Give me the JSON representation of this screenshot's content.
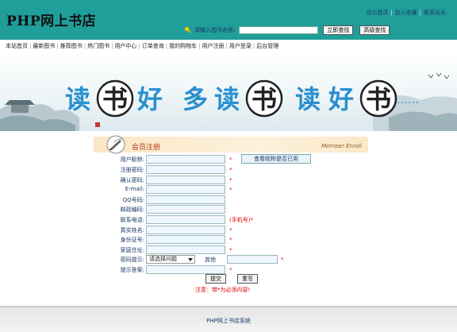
{
  "header": {
    "site_title": "PHP网上书店",
    "top_links": [
      "设为首页",
      "加入收藏",
      "联系站长"
    ],
    "search": {
      "label": "请输入图书名称:",
      "value": "",
      "placeholder": "",
      "buttons": [
        "立即查找",
        "高级查找"
      ]
    }
  },
  "nav": {
    "items": [
      "本站首页",
      "最新图书",
      "推荐图书",
      "热门图书",
      "用户中心",
      "订单查询",
      "我的购物车",
      "用户注册",
      "用户登录",
      "后台管理"
    ]
  },
  "banner": {
    "slogan_parts": [
      "读",
      "书",
      "好",
      "多",
      "读",
      "书",
      "读",
      "好",
      "书",
      "……"
    ]
  },
  "form": {
    "title": "会员注册",
    "title_en": "Member Enroll",
    "fields": [
      {
        "label": "用户昵称:",
        "value": "",
        "required": true
      },
      {
        "label": "注册密码:",
        "value": "",
        "required": true
      },
      {
        "label": "确认密码:",
        "value": "",
        "required": true
      },
      {
        "label": "E-mail:",
        "value": "",
        "required": true
      },
      {
        "label": "QQ号码:",
        "value": "",
        "required": false
      },
      {
        "label": "邮政编码:",
        "value": "",
        "required": false
      },
      {
        "label": "联系电话:",
        "value": "",
        "required": true,
        "hint": "(手机号)*"
      },
      {
        "label": "真实姓名:",
        "value": "",
        "required": true
      },
      {
        "label": "身份证号:",
        "value": "",
        "required": true
      },
      {
        "label": "家庭住址:",
        "value": "",
        "required": true
      }
    ],
    "check_button": "查看昵称是否已用",
    "question": {
      "label": "密码提示:",
      "selected": "请选择问题",
      "other_label": "其他",
      "other_value": ""
    },
    "answer": {
      "label": "提示答案:",
      "value": ""
    },
    "star": "*",
    "submit_label": "提交",
    "reset_label": "重写",
    "notice": "注意：带*为必添内容!"
  },
  "footer": {
    "text": "PHP网上书店系统"
  },
  "colors": {
    "header_bg": "#1f9e9a",
    "required": "#dd0000",
    "label": "#1a3a6a",
    "slogan": "#2a8fd0"
  }
}
